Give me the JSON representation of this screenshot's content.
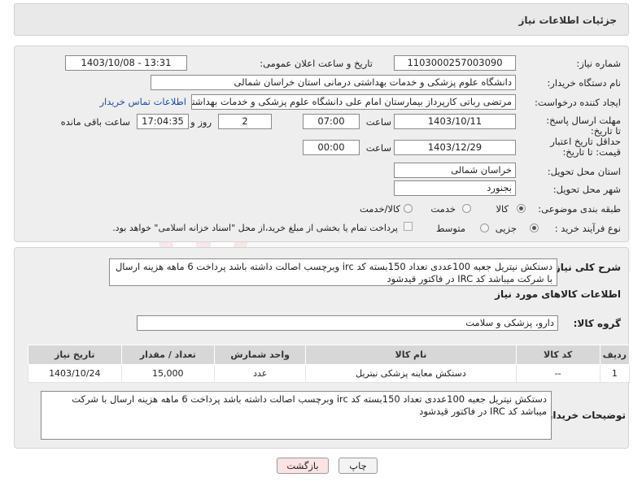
{
  "page": {
    "title": "جزئیات اطلاعات نیاز"
  },
  "form": {
    "need_number_label": "شماره نیاز:",
    "need_number": "1103000257003090",
    "announce_label": "تاریخ و ساعت اعلان عمومی:",
    "announce_value": "1403/10/08 - 13:31",
    "buyer_label": "نام دستگاه خریدار:",
    "buyer_value": "دانشگاه علوم پزشکی و خدمات بهداشتی درمانی استان خراسان شمالی",
    "creator_label": "ایجاد کننده درخواست:",
    "creator_value": "مرتضی رباتی کارپرداز بیمارستان امام علی دانشگاه علوم پزشکی و خدمات بهداشتی",
    "contact_link": "اطلاعات تماس خریدار",
    "deadline_label": "مهلت ارسال پاسخ: تا تاریخ:",
    "deadline_date": "1403/10/11",
    "time_label": "ساعت",
    "deadline_time": "07:00",
    "days_value": "2",
    "days_label": "روز و",
    "remaining_value": "17:04:35",
    "remaining_label": "ساعت باقی مانده",
    "validity_label": "حداقل تاریخ اعتبار قیمت: تا تاریخ:",
    "validity_date": "1403/12/29",
    "validity_time_label": "ساعت",
    "validity_time": "00:00",
    "province_label": "استان محل تحویل:",
    "province_value": "خراسان شمالی",
    "city_label": "شهر محل تحویل:",
    "city_value": "بجنورد",
    "category_label": "طبقه بندی موضوعی:",
    "category_options": [
      "کالا",
      "خدمت",
      "کالا/خدمت"
    ],
    "category_selected": "کالا",
    "process_label": "نوع فرآیند خرید :",
    "process_options": [
      "جزیی",
      "متوسط"
    ],
    "process_selected": "جزیی",
    "payment_note": "پرداخت تمام یا بخشی از مبلغ خرید،از محل \"اسناد خزانه اسلامی\" خواهد بود."
  },
  "description": {
    "label": "شرح کلی نیاز:",
    "text": "دستکش نیتریل جعبه 100عددی تعداد 150بسته کد irc وبرچسب اصالت داشته باشد پرداخت 6 ماهه هزینه ارسال با شرکت میباشد کد IRC در فاکتور قیدشود"
  },
  "goods": {
    "section_title": "اطلاعات کالاهای مورد نیاز",
    "group_label": "گروه کالا:",
    "group_value": "دارو، پزشکی و سلامت",
    "columns": [
      "ردیف",
      "کد کالا",
      "نام کالا",
      "واحد شمارش",
      "تعداد / مقدار",
      "تاریخ نیاز"
    ],
    "rows": [
      [
        "1",
        "--",
        "دستکش معاینه پزشکی نیتریل",
        "عدد",
        "15,000",
        "1403/10/24"
      ]
    ]
  },
  "buyer_notes": {
    "label": "توضیحات خریدار:",
    "text": "دستکش نیتریل جعبه 100عددی تعداد 150بسته کد irc وبرچسب اصالت داشته باشد پرداخت 6 ماهه هزینه ارسال با شرکت میباشد کد IRC در فاکتور قیدشود"
  },
  "buttons": {
    "print": "چاپ",
    "back": "بازگشت"
  },
  "colors": {
    "link": "#1a4fa3",
    "back_button_bg": "#fbe3e3",
    "panel_bg": "#eeeeee"
  }
}
